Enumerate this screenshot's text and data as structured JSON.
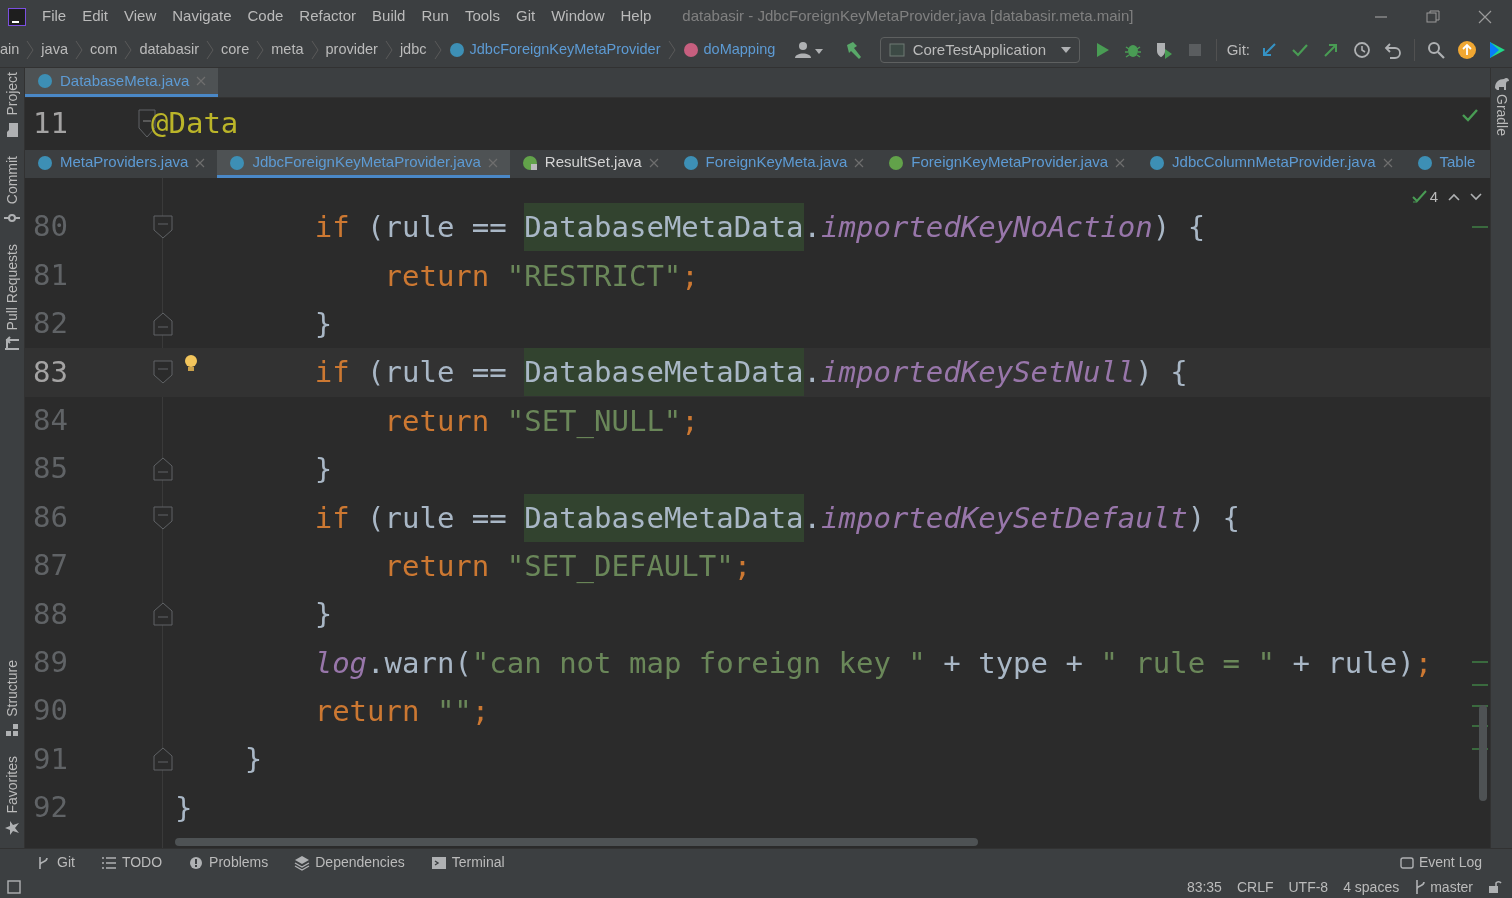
{
  "menu": [
    "File",
    "Edit",
    "View",
    "Navigate",
    "Code",
    "Refactor",
    "Build",
    "Run",
    "Tools",
    "Git",
    "Window",
    "Help"
  ],
  "window_title": "databasir - JdbcForeignKeyMetaProvider.java [databasir.meta.main]",
  "breadcrumbs": [
    {
      "label": "ain",
      "kind": "folder"
    },
    {
      "label": "java",
      "kind": "folder"
    },
    {
      "label": "com",
      "kind": "folder"
    },
    {
      "label": "databasir",
      "kind": "folder"
    },
    {
      "label": "core",
      "kind": "folder"
    },
    {
      "label": "meta",
      "kind": "folder"
    },
    {
      "label": "provider",
      "kind": "folder"
    },
    {
      "label": "jdbc",
      "kind": "folder"
    },
    {
      "label": "JdbcForeignKeyMetaProvider",
      "kind": "class"
    },
    {
      "label": "doMapping",
      "kind": "method"
    }
  ],
  "toolbar": {
    "run_config": "CoreTestApplication",
    "git_label": "Git:"
  },
  "left_tool_windows": [
    {
      "label": "Project",
      "kind": "folder"
    },
    {
      "label": "Commit",
      "kind": "commit"
    },
    {
      "label": "Pull Requests",
      "kind": "pull"
    },
    {
      "label": "Structure",
      "kind": "structure"
    },
    {
      "label": "Favorites",
      "kind": "star"
    }
  ],
  "right_tool_windows": [
    {
      "label": "Gradle"
    }
  ],
  "top_pane": {
    "tabs": [
      {
        "label": "DatabaseMeta.java",
        "kind": "class",
        "color": "#5d9bd4",
        "selected": true
      }
    ],
    "line": {
      "number": "11",
      "tokens": [
        {
          "kind": "annotation",
          "text": "@Data"
        }
      ]
    }
  },
  "editor": {
    "tabs": [
      {
        "label": "MetaProviders.java",
        "kind": "class",
        "color": "#5d9bd4",
        "selected": false
      },
      {
        "label": "JdbcForeignKeyMetaProvider.java",
        "kind": "class",
        "color": "#5d9bd4",
        "selected": true
      },
      {
        "label": "ResultSet.java",
        "kind": "library",
        "color": "#d4d4d4",
        "selected": false
      },
      {
        "label": "ForeignKeyMeta.java",
        "kind": "class",
        "color": "#5d9bd4",
        "selected": false
      },
      {
        "label": "ForeignKeyMetaProvider.java",
        "kind": "interface",
        "color": "#5d9bd4",
        "selected": false
      },
      {
        "label": "JdbcColumnMetaProvider.java",
        "kind": "class",
        "color": "#5d9bd4",
        "selected": false
      },
      {
        "label": "Table",
        "kind": "class",
        "color": "#5d9bd4",
        "selected": false
      }
    ],
    "inspection_count": "4",
    "lines": [
      {
        "number": "80",
        "current": false,
        "fold_start": true,
        "fold_end": false,
        "bulb": false,
        "tokens": [
          {
            "kind": "keyword",
            "text": "        if"
          },
          {
            "kind": "plain",
            "text": " (rule == "
          },
          {
            "kind": "highlight",
            "text": "DatabaseMetaData"
          },
          {
            "kind": "plain",
            "text": "."
          },
          {
            "kind": "field",
            "text": "importedKeyNoAction"
          },
          {
            "kind": "plain",
            "text": ") {"
          }
        ]
      },
      {
        "number": "81",
        "current": false,
        "fold_start": false,
        "fold_end": false,
        "bulb": false,
        "tokens": [
          {
            "kind": "keyword",
            "text": "            return "
          },
          {
            "kind": "string",
            "text": "\"RESTRICT\""
          },
          {
            "kind": "keyword",
            "text": ";"
          }
        ]
      },
      {
        "number": "82",
        "current": false,
        "fold_start": false,
        "fold_end": true,
        "bulb": false,
        "tokens": [
          {
            "kind": "plain",
            "text": "        }"
          }
        ]
      },
      {
        "number": "83",
        "current": true,
        "fold_start": true,
        "fold_end": false,
        "bulb": true,
        "tokens": [
          {
            "kind": "keyword",
            "text": "        if"
          },
          {
            "kind": "plain",
            "text": " (rule == "
          },
          {
            "kind": "highlight",
            "text": "DatabaseMetaData"
          },
          {
            "kind": "plain",
            "text": "."
          },
          {
            "kind": "field",
            "text": "importedKeySetNull"
          },
          {
            "kind": "plain",
            "text": ") {"
          }
        ]
      },
      {
        "number": "84",
        "current": false,
        "fold_start": false,
        "fold_end": false,
        "bulb": false,
        "tokens": [
          {
            "kind": "keyword",
            "text": "            return "
          },
          {
            "kind": "string",
            "text": "\"SET_NULL\""
          },
          {
            "kind": "keyword",
            "text": ";"
          }
        ]
      },
      {
        "number": "85",
        "current": false,
        "fold_start": false,
        "fold_end": true,
        "bulb": false,
        "tokens": [
          {
            "kind": "plain",
            "text": "        }"
          }
        ]
      },
      {
        "number": "86",
        "current": false,
        "fold_start": true,
        "fold_end": false,
        "bulb": false,
        "tokens": [
          {
            "kind": "keyword",
            "text": "        if"
          },
          {
            "kind": "plain",
            "text": " (rule == "
          },
          {
            "kind": "highlight",
            "text": "DatabaseMetaData"
          },
          {
            "kind": "plain",
            "text": "."
          },
          {
            "kind": "field",
            "text": "importedKeySetDefault"
          },
          {
            "kind": "plain",
            "text": ") {"
          }
        ]
      },
      {
        "number": "87",
        "current": false,
        "fold_start": false,
        "fold_end": false,
        "bulb": false,
        "tokens": [
          {
            "kind": "keyword",
            "text": "            return "
          },
          {
            "kind": "string",
            "text": "\"SET_DEFAULT\""
          },
          {
            "kind": "keyword",
            "text": ";"
          }
        ]
      },
      {
        "number": "88",
        "current": false,
        "fold_start": false,
        "fold_end": true,
        "bulb": false,
        "tokens": [
          {
            "kind": "plain",
            "text": "        }"
          }
        ]
      },
      {
        "number": "89",
        "current": false,
        "fold_start": false,
        "fold_end": false,
        "bulb": false,
        "tokens": [
          {
            "kind": "field",
            "text": "        log"
          },
          {
            "kind": "plain",
            "text": ".warn("
          },
          {
            "kind": "string",
            "text": "\"can not map foreign key \""
          },
          {
            "kind": "plain",
            "text": " + type + "
          },
          {
            "kind": "string",
            "text": "\" rule = \""
          },
          {
            "kind": "plain",
            "text": " + rule)"
          },
          {
            "kind": "keyword",
            "text": ";"
          }
        ]
      },
      {
        "number": "90",
        "current": false,
        "fold_start": false,
        "fold_end": false,
        "bulb": false,
        "tokens": [
          {
            "kind": "keyword",
            "text": "        return "
          },
          {
            "kind": "string",
            "text": "\"\""
          },
          {
            "kind": "keyword",
            "text": ";"
          }
        ]
      },
      {
        "number": "91",
        "current": false,
        "fold_start": false,
        "fold_end": true,
        "bulb": false,
        "tokens": [
          {
            "kind": "plain",
            "text": "    }"
          }
        ]
      },
      {
        "number": "92",
        "current": false,
        "fold_start": false,
        "fold_end": false,
        "bulb": false,
        "tokens": [
          {
            "kind": "plain",
            "text": "}"
          }
        ]
      }
    ]
  },
  "bottom_tools": [
    {
      "label": "Git",
      "kind": "branch"
    },
    {
      "label": "TODO",
      "kind": "list"
    },
    {
      "label": "Problems",
      "kind": "problems"
    },
    {
      "label": "Dependencies",
      "kind": "layers"
    },
    {
      "label": "Terminal",
      "kind": "terminal"
    }
  ],
  "event_log": "Event Log",
  "status_bar": {
    "position": "83:35",
    "line_separator": "CRLF",
    "encoding": "UTF-8",
    "indent": "4 spaces",
    "branch": "master"
  }
}
